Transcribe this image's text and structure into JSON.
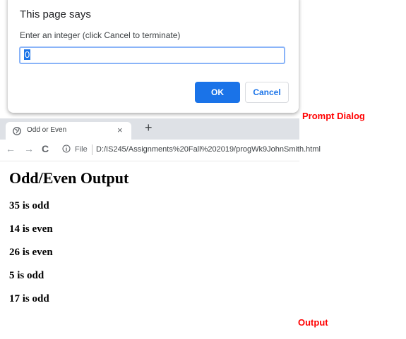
{
  "dialog": {
    "title": "This page says",
    "message": "Enter an integer (click Cancel to terminate)",
    "input_value": "0",
    "ok_label": "OK",
    "cancel_label": "Cancel"
  },
  "annotations": {
    "prompt_label": "Prompt Dialog",
    "output_label": "Output",
    "color": "#ff0000"
  },
  "browser": {
    "tab_title": "Odd or Even",
    "tab_icon": "globe-icon",
    "close_icon": "×",
    "new_tab_icon": "+",
    "back_icon": "←",
    "forward_icon": "→",
    "reload_icon": "C",
    "scheme_label": "File",
    "url": "D:/IS245/Assignments%20Fall%202019/progWk9JohnSmith.html"
  },
  "page": {
    "heading": "Odd/Even Output",
    "results": [
      "35 is odd",
      "14 is even",
      "26 is even",
      "5 is odd",
      "17 is odd"
    ]
  },
  "colors": {
    "accent": "#1a73e8",
    "tabstrip": "#dee1e6"
  }
}
